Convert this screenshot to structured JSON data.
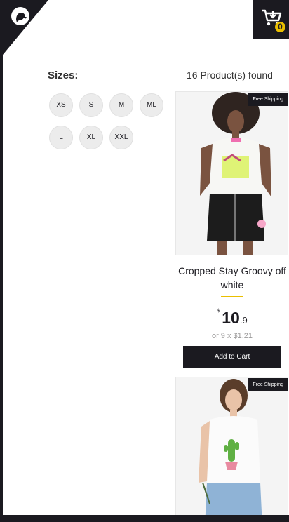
{
  "header": {
    "cart_count": "0"
  },
  "filters": {
    "title": "Sizes:",
    "sizes": [
      "XS",
      "S",
      "M",
      "ML",
      "L",
      "XL",
      "XXL"
    ]
  },
  "results": {
    "count_text": "16 Product(s) found"
  },
  "products": [
    {
      "badge": "Free Shipping",
      "title": "Cropped Stay Groovy off white",
      "currency": "$",
      "price_whole": "10",
      "price_cents": ".9",
      "installment": "or 9 x $1.21",
      "add_to_cart": "Add to Cart"
    },
    {
      "badge": "Free Shipping",
      "title": "",
      "currency": "",
      "price_whole": "",
      "price_cents": "",
      "installment": "",
      "add_to_cart": ""
    }
  ],
  "colors": {
    "dark": "#1b1a20",
    "accent": "#eabf00",
    "muted": "#9c9b9b"
  }
}
